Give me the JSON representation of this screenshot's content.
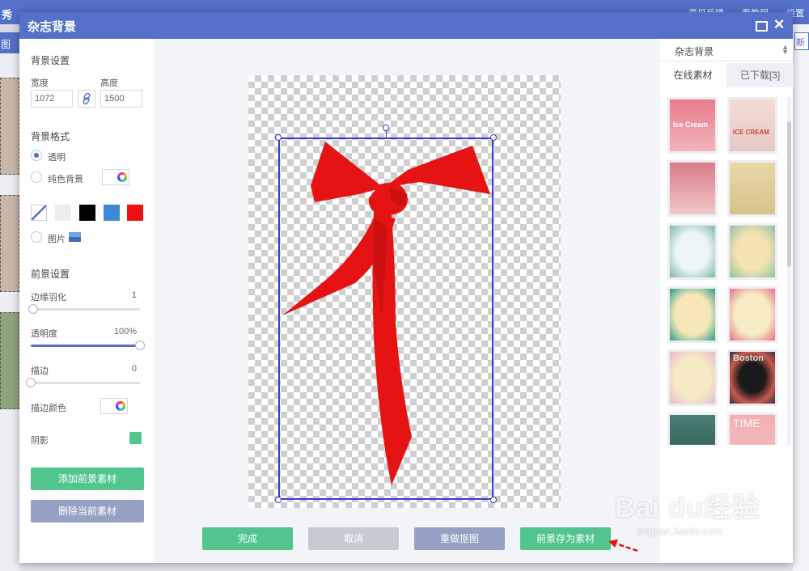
{
  "background_app": {
    "logo": "秀",
    "top_items": [
      "意见反馈",
      "看教程",
      "设置"
    ],
    "left_tab": "图片",
    "right_tab": "新"
  },
  "dialog": {
    "title": "杂志背景",
    "background_settings": {
      "title": "背景设置",
      "width_label": "宽度",
      "width_value": "1072",
      "height_label": "高度",
      "height_value": "1500"
    },
    "background_format": {
      "title": "背景格式",
      "options": [
        "透明",
        "纯色背景",
        "图片"
      ],
      "selected": "透明",
      "swatches": [
        "transparent",
        "#eeeeee",
        "#000000",
        "#3f88d6",
        "#ee1111"
      ]
    },
    "foreground_settings": {
      "title": "前景设置",
      "feather_label": "边缘羽化",
      "feather_value": "1",
      "feather_level": 0.02,
      "opacity_label": "透明度",
      "opacity_value": "100%",
      "opacity_level": 1.0,
      "stroke_label": "描边",
      "stroke_value": "0",
      "stroke_level": 0.0,
      "stroke_color_label": "描边颜色",
      "shadow_label": "阴影",
      "shadow_color": "#52c58f"
    },
    "add_foreground_button": "添加前景素材",
    "delete_foreground_button": "删除当前素材",
    "footer": {
      "done": "完成",
      "cancel": "取消",
      "redo_matting": "重做抠图",
      "save_foreground": "前景存为素材"
    },
    "material_panel": {
      "dropdown": "杂志背景",
      "tabs": [
        "在线素材",
        "已下载[3]"
      ],
      "active_tab": "在线素材",
      "thumb_texts": [
        "Ice Cream",
        "ICE CREAM",
        "Boston",
        "TIME"
      ]
    }
  },
  "watermark": {
    "brand": "Bai du经验",
    "url": "jingyan.baidu.com"
  },
  "colors": {
    "primary": "#5470c9",
    "green": "#52c58f",
    "disabled": "#c7cad2",
    "secondary": "#97a1c4",
    "ribbon": "#e51313"
  }
}
